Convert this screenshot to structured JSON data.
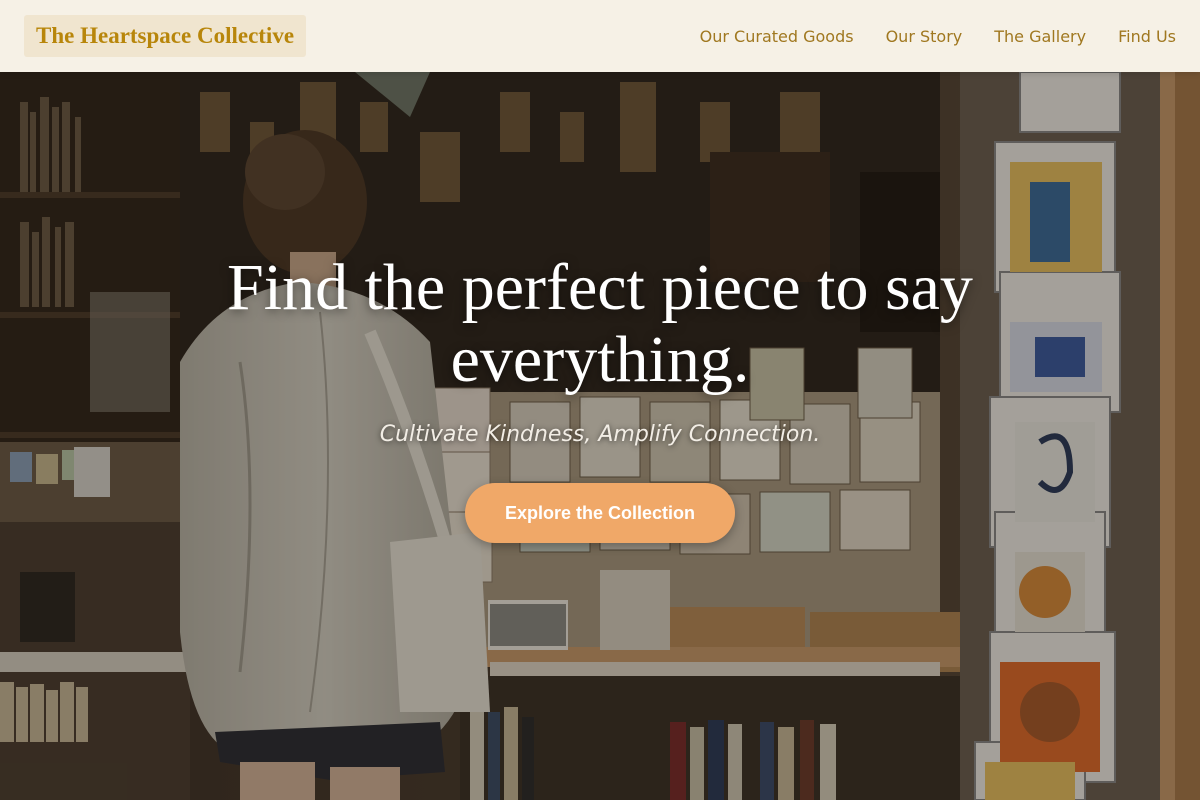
{
  "header": {
    "brand": "The Heartspace Collective",
    "nav": [
      "Our Curated Goods",
      "Our Story",
      "The Gallery",
      "Find Us"
    ]
  },
  "hero": {
    "headline": "Find the perfect piece to say everything.",
    "tagline": "Cultivate Kindness, Amplify Connection.",
    "cta_label": "Explore the Collection",
    "background_image": "photo-shopper-browsing-greeting-cards-in-shop"
  },
  "colors": {
    "header_bg": "#f6f1e6",
    "brand_text": "#b8860b",
    "nav_text": "#a07820",
    "cta_bg": "#f0a868"
  }
}
